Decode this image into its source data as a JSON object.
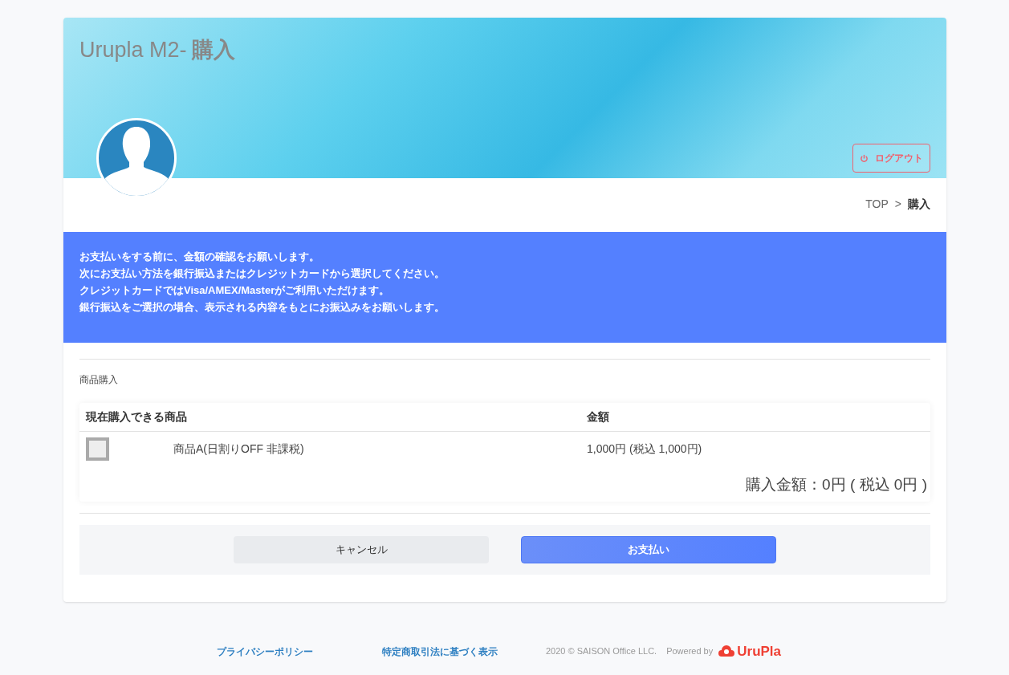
{
  "header": {
    "title": "Urupla M2-",
    "title_bold": "購入",
    "logout_button": "ログアウト"
  },
  "breadcrumb": [
    {
      "label": "TOP",
      "current": false
    },
    {
      "label": "購入",
      "current": true
    }
  ],
  "breadcrumb_separator": ">",
  "notice": [
    "お支払いをする前に、金額の確認をお願いします。",
    "次にお支払い方法を銀行振込またはクレジットカードから選択してください。",
    "クレジットカードではVisa/AMEX/Masterがご利用いただけます。",
    "銀行振込をご選択の場合、表示される内容をもとにお振込みをお願いします。"
  ],
  "section_title": "商品購入",
  "table": {
    "columns": [
      "現在購入できる商品",
      "金額"
    ],
    "rows": [
      {
        "checked": false,
        "name": "商品A(日割りOFF 非課税)",
        "price": "1,000円 (税込 1,000円)"
      }
    ],
    "total": "購入金額：0円 ( 税込 0円 )"
  },
  "buttons": [
    {
      "label": "キャンセル",
      "kind": "secondary"
    },
    {
      "label": "お支払い",
      "kind": "primary"
    }
  ],
  "footer": {
    "links": [
      "プライバシーポリシー",
      "特定商取引法に基づく表示"
    ],
    "copyright": "2020 © SAISON Office LLC.",
    "powered_by": "Powered by",
    "logo_text": "UruPla"
  }
}
